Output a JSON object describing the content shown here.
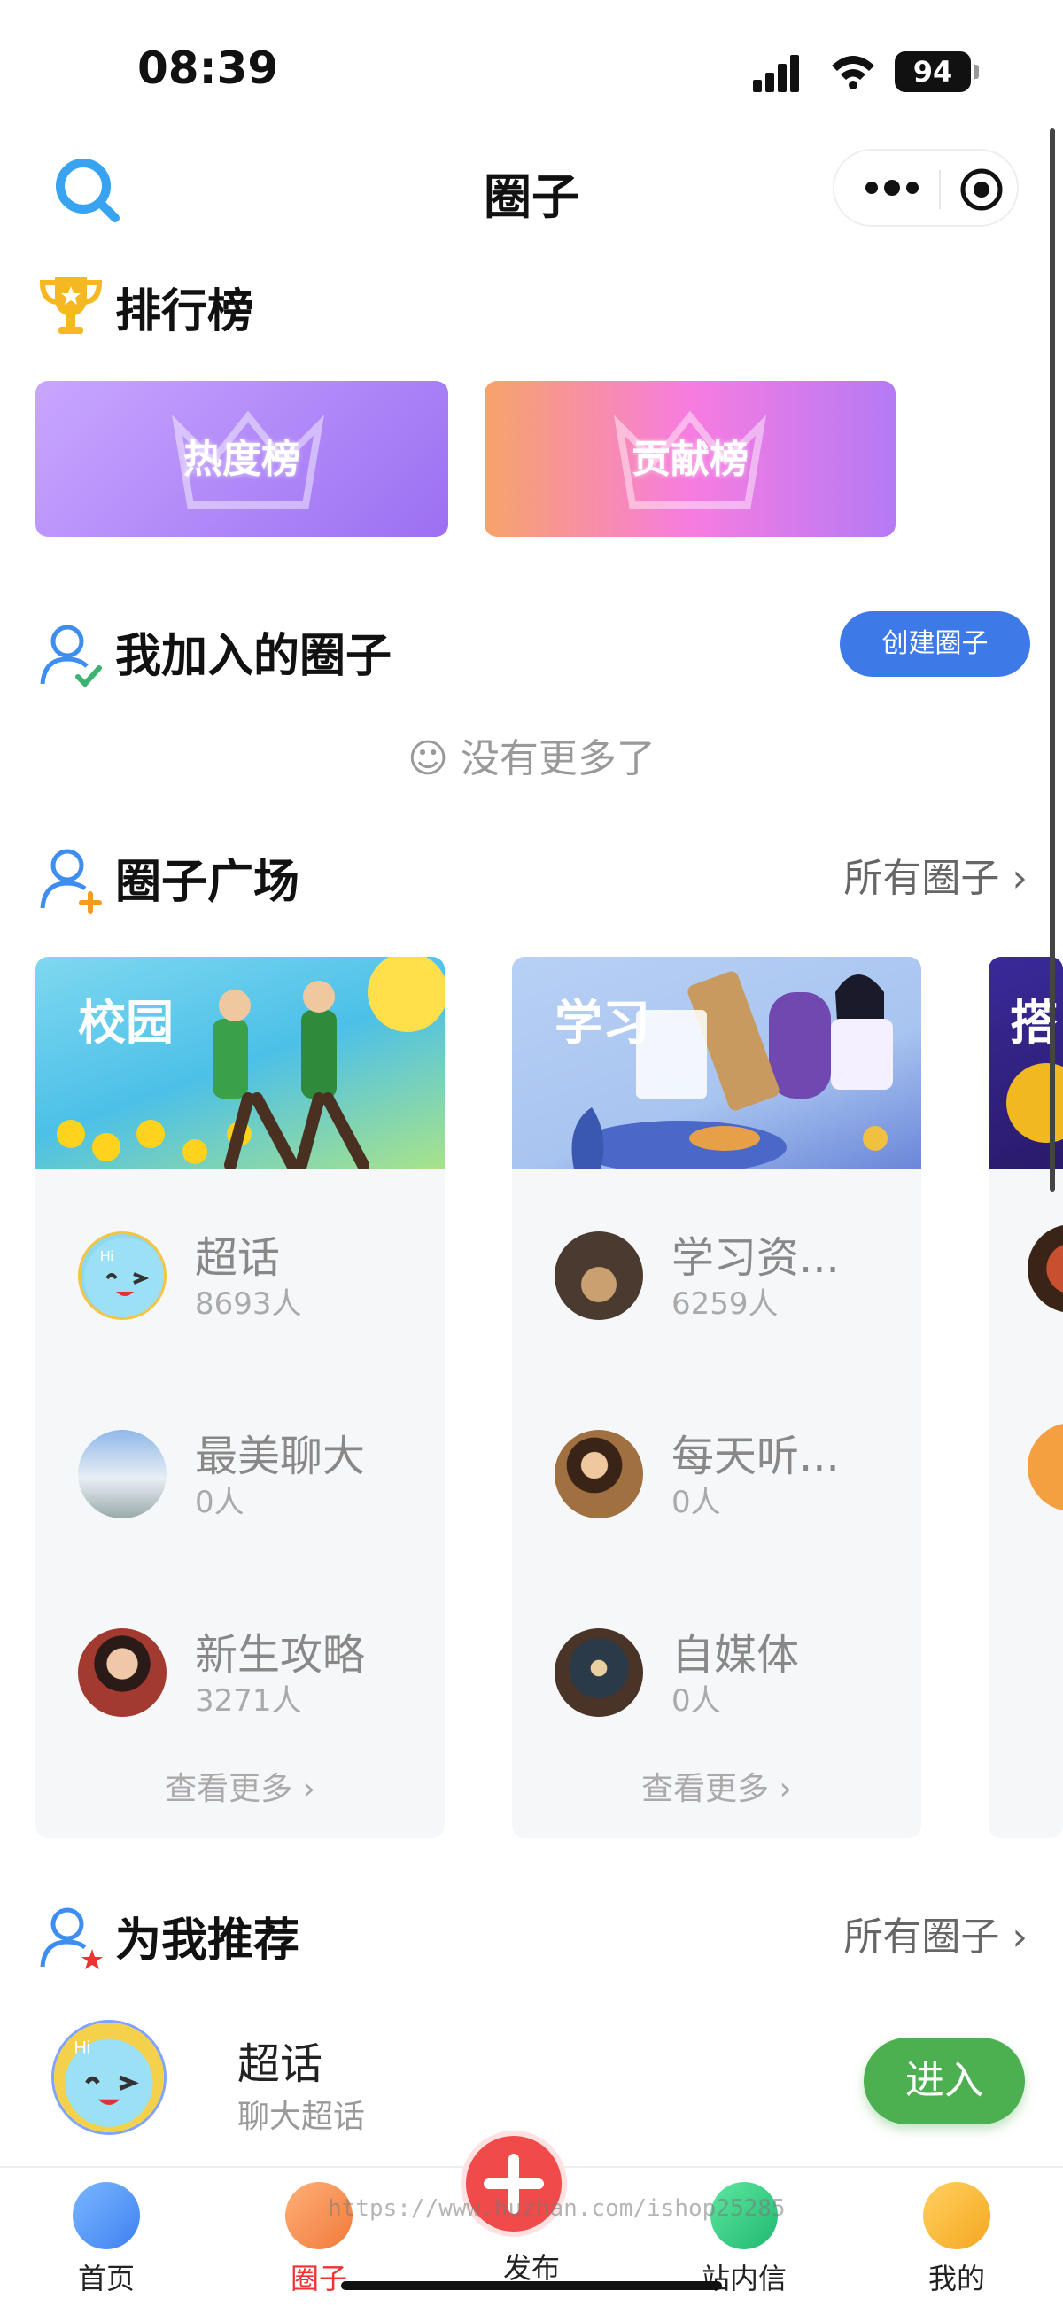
{
  "status_bar": {
    "time": "08:39",
    "battery": "94"
  },
  "nav": {
    "title": "圈子"
  },
  "ranking": {
    "title": "排行榜",
    "cards": [
      {
        "label": "热度榜"
      },
      {
        "label": "贡献榜"
      }
    ]
  },
  "my_circles": {
    "title": "我加入的圈子",
    "create_button": "创建圈子",
    "empty_text": "没有更多了"
  },
  "plaza": {
    "title": "圈子广场",
    "more": "所有圈子",
    "cards": [
      {
        "banner": "校园",
        "items": [
          {
            "name": "超话",
            "count": "8693人"
          },
          {
            "name": "最美聊大",
            "count": "0人"
          },
          {
            "name": "新生攻略",
            "count": "3271人"
          }
        ],
        "see_more": "查看更多"
      },
      {
        "banner": "学习",
        "items": [
          {
            "name": "学习资...",
            "count": "6259人"
          },
          {
            "name": "每天听...",
            "count": "0人"
          },
          {
            "name": "自媒体",
            "count": "0人"
          }
        ],
        "see_more": "查看更多"
      }
    ],
    "partial_banner": "搭"
  },
  "recommend": {
    "title": "为我推荐",
    "more": "所有圈子",
    "item": {
      "name": "超话",
      "desc": "聊大超话",
      "button": "进入"
    }
  },
  "tabbar": {
    "items": [
      {
        "label": "首页"
      },
      {
        "label": "圈子"
      },
      {
        "label": "发布"
      },
      {
        "label": "站内信"
      },
      {
        "label": "我的"
      }
    ]
  },
  "watermark": "https://www.huzhan.com/ishop25285"
}
